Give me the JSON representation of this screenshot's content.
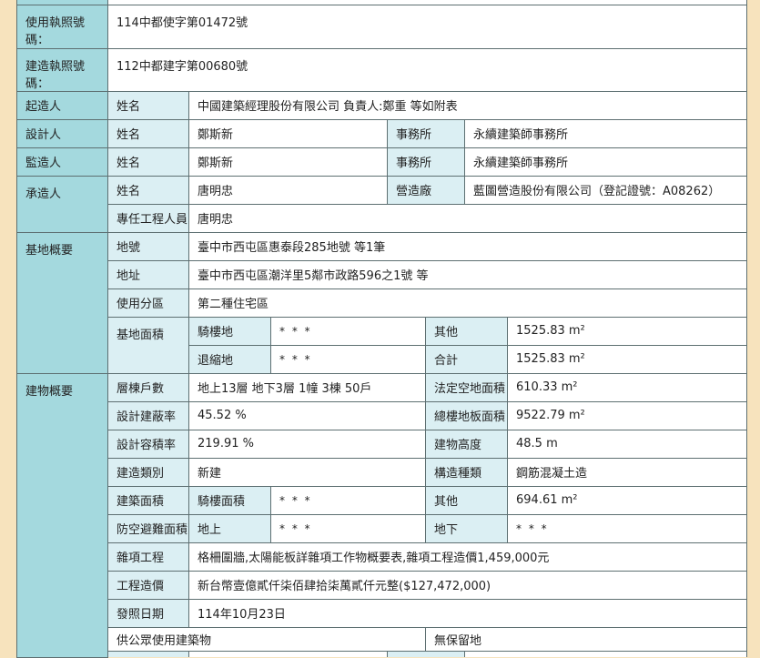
{
  "permit": {
    "use_license": {
      "label": "使用執照號碼：",
      "value": "114中都使字第01472號"
    },
    "build_license": {
      "label": "建造執照號碼：",
      "value": "112中都建字第00680號"
    },
    "applicant": {
      "label": "起造人",
      "name_label": "姓名",
      "name": "中國建築經理股份有限公司 負責人:鄭重 等如附表"
    },
    "designer": {
      "label": "設計人",
      "name_label": "姓名",
      "name": "鄭斯新",
      "office_label": "事務所",
      "office": "永續建築師事務所"
    },
    "supervisor": {
      "label": "監造人",
      "name_label": "姓名",
      "name": "鄭斯新",
      "office_label": "事務所",
      "office": "永續建築師事務所"
    },
    "contractor": {
      "label": "承造人",
      "name_label": "姓名",
      "name": "唐明忠",
      "firm_label": "營造廠",
      "firm": "藍圖營造股份有限公司（登記證號：A08262）",
      "engineer_label": "專任工程人員",
      "engineer": "唐明忠"
    },
    "site": {
      "label": "基地概要",
      "lot": {
        "label": "地號",
        "value": "臺中市西屯區惠泰段285地號 等1筆"
      },
      "address": {
        "label": "地址",
        "value": "臺中市西屯區潮洋里5鄰市政路596之1號 等"
      },
      "zoning": {
        "label": "使用分區",
        "value": "第二種住宅區"
      },
      "area": {
        "label": "基地面積",
        "arcade": {
          "label": "騎樓地",
          "value": "* * *"
        },
        "other": {
          "label": "其他",
          "value": "1525.83 m²"
        },
        "setback": {
          "label": "退縮地",
          "value": "* * *"
        },
        "total": {
          "label": "合計",
          "value": "1525.83 m²"
        }
      }
    },
    "building": {
      "label": "建物概要",
      "floors": {
        "label": "層棟戶數",
        "value": "地上13層 地下3層 1幢 3棟 50戶"
      },
      "open_space": {
        "label": "法定空地面積",
        "value": "610.33 m²"
      },
      "coverage": {
        "label": "設計建蔽率",
        "value": "45.52 %"
      },
      "total_floor": {
        "label": "總樓地板面積",
        "value": "9522.79 m²"
      },
      "far": {
        "label": "設計容積率",
        "value": "219.91 %"
      },
      "height": {
        "label": "建物高度",
        "value": "48.5 m"
      },
      "build_type": {
        "label": "建造類別",
        "value": "新建"
      },
      "structure": {
        "label": "構造種類",
        "value": "鋼筋混凝土造"
      },
      "built_area": {
        "label": "建築面積",
        "arcade_label": "騎樓面積",
        "arcade": "* * *",
        "other_label": "其他",
        "other": "694.61 m²"
      },
      "shelter": {
        "label": "防空避難面積",
        "above_label": "地上",
        "above": "* * *",
        "below_label": "地下",
        "below": "* * *"
      },
      "misc": {
        "label": "雜項工程",
        "value": "格柵圍牆,太陽能板詳雜項工作物概要表,雜項工程造價1,459,000元"
      },
      "cost": {
        "label": "工程造價",
        "value": "新台幣壹億貳仟柒佰肆拾柒萬貳仟元整($127,472,000)"
      },
      "issue_date": {
        "label": "發照日期",
        "value": "114年10月23日"
      },
      "public_use": {
        "label": "供公眾使用建築物",
        "reserved": "無保留地"
      }
    }
  }
}
